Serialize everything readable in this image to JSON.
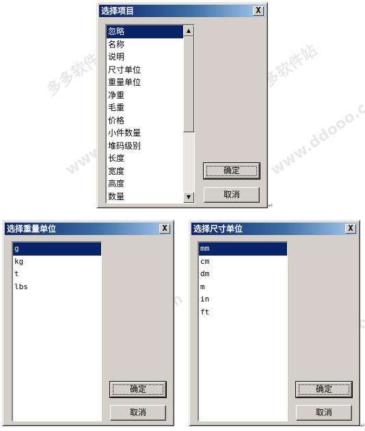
{
  "dialog_items": {
    "title": "选择项目",
    "close_glyph": "X",
    "items": [
      "忽略",
      "名称",
      "说明",
      "尺寸单位",
      "重量单位",
      "净重",
      "毛重",
      "价格",
      "小件数量",
      "堆码级别",
      "长度",
      "宽度",
      "高度",
      "数量"
    ],
    "selected_index": 0,
    "ok_label": "确定",
    "cancel_label": "取消"
  },
  "dialog_weight": {
    "title": "选择重量单位",
    "close_glyph": "X",
    "items": [
      "g",
      "kg",
      "t",
      "lbs"
    ],
    "selected_index": 0,
    "ok_label": "确定",
    "cancel_label": "取消"
  },
  "dialog_size": {
    "title": "选择尺寸单位",
    "close_glyph": "X",
    "items": [
      "mm",
      "cm",
      "dm",
      "m",
      "in",
      "ft"
    ],
    "selected_index": 0,
    "ok_label": "确定",
    "cancel_label": "取消"
  },
  "watermarks": [
    "多多软件站",
    "www.ddooo.com"
  ],
  "icons": {
    "scroll_up": "scroll-up-arrow-icon",
    "scroll_down": "scroll-down-arrow-icon",
    "close": "close-x-icon"
  },
  "colors": {
    "titlebar_start": "#0a246a",
    "titlebar_end": "#a6caf0",
    "selection": "#0a246a",
    "dialog_bg": "#d4d0c8"
  }
}
